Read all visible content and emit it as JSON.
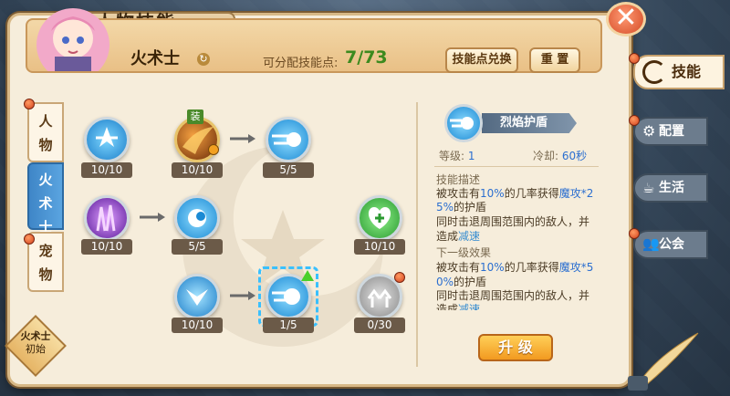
{
  "title": "人物技能",
  "close_label": "✕",
  "header": {
    "class_name": "火术士",
    "points_label": "可分配技能点:",
    "points_current": "7",
    "points_sep": "/",
    "points_total": "73",
    "exchange_button": "技能点兑换",
    "reset_button": "重 置"
  },
  "left_tabs": [
    {
      "label": "人\n物",
      "active": false
    },
    {
      "label": "火\n术\n士",
      "active": true
    },
    {
      "label": "宠\n物",
      "active": false
    }
  ],
  "class_badge": {
    "line1": "火术士",
    "line2": "初始"
  },
  "skills": [
    {
      "count": "10/10"
    },
    {
      "count": "10/10",
      "tag": "装"
    },
    {
      "count": "5/5"
    },
    {
      "count": "10/10"
    },
    {
      "count": "5/5"
    },
    {
      "count": "10/10"
    },
    {
      "count": "10/10"
    },
    {
      "count": "1/5"
    },
    {
      "count": "0/30"
    }
  ],
  "detail": {
    "name": "烈焰护盾",
    "level_label": "等级:",
    "level": "1",
    "cd_label": "冷却:",
    "cd": "60秒",
    "desc_title": "技能描述",
    "desc_line1_a": "被攻击有",
    "desc_line1_b": "10%",
    "desc_line1_c": "的几率获得",
    "desc_line1_d": "魔攻*2",
    "desc_line2_a": "5%",
    "desc_line2_b": "的护盾",
    "desc_line3": "同时击退周围范围内的敌人，并",
    "desc_line4_a": "造成",
    "desc_line4_b": "减速",
    "next_title": "下一级效果",
    "next_line1_a": "被攻击有",
    "next_line1_b": "10%",
    "next_line1_c": "的几率获得",
    "next_line1_d": "魔攻*5",
    "next_line2_a": "0%",
    "next_line2_b": "的护盾",
    "next_line3": "同时击退周围范围内的敌人，并",
    "next_line4_a": "造成",
    "next_line4_b": "减速",
    "upgrade_button": "升 级"
  },
  "side_nav": [
    {
      "label": "技能",
      "icon": "skill-swirl-icon"
    },
    {
      "label": "配置",
      "icon": "gear-icon"
    },
    {
      "label": "生活",
      "icon": "teacup-icon"
    },
    {
      "label": "公会",
      "icon": "guild-people-icon"
    }
  ],
  "colors": {
    "accent_green": "#3c8a1e",
    "accent_blue": "#2c6fd0",
    "tab_active": "#3f86c7"
  }
}
